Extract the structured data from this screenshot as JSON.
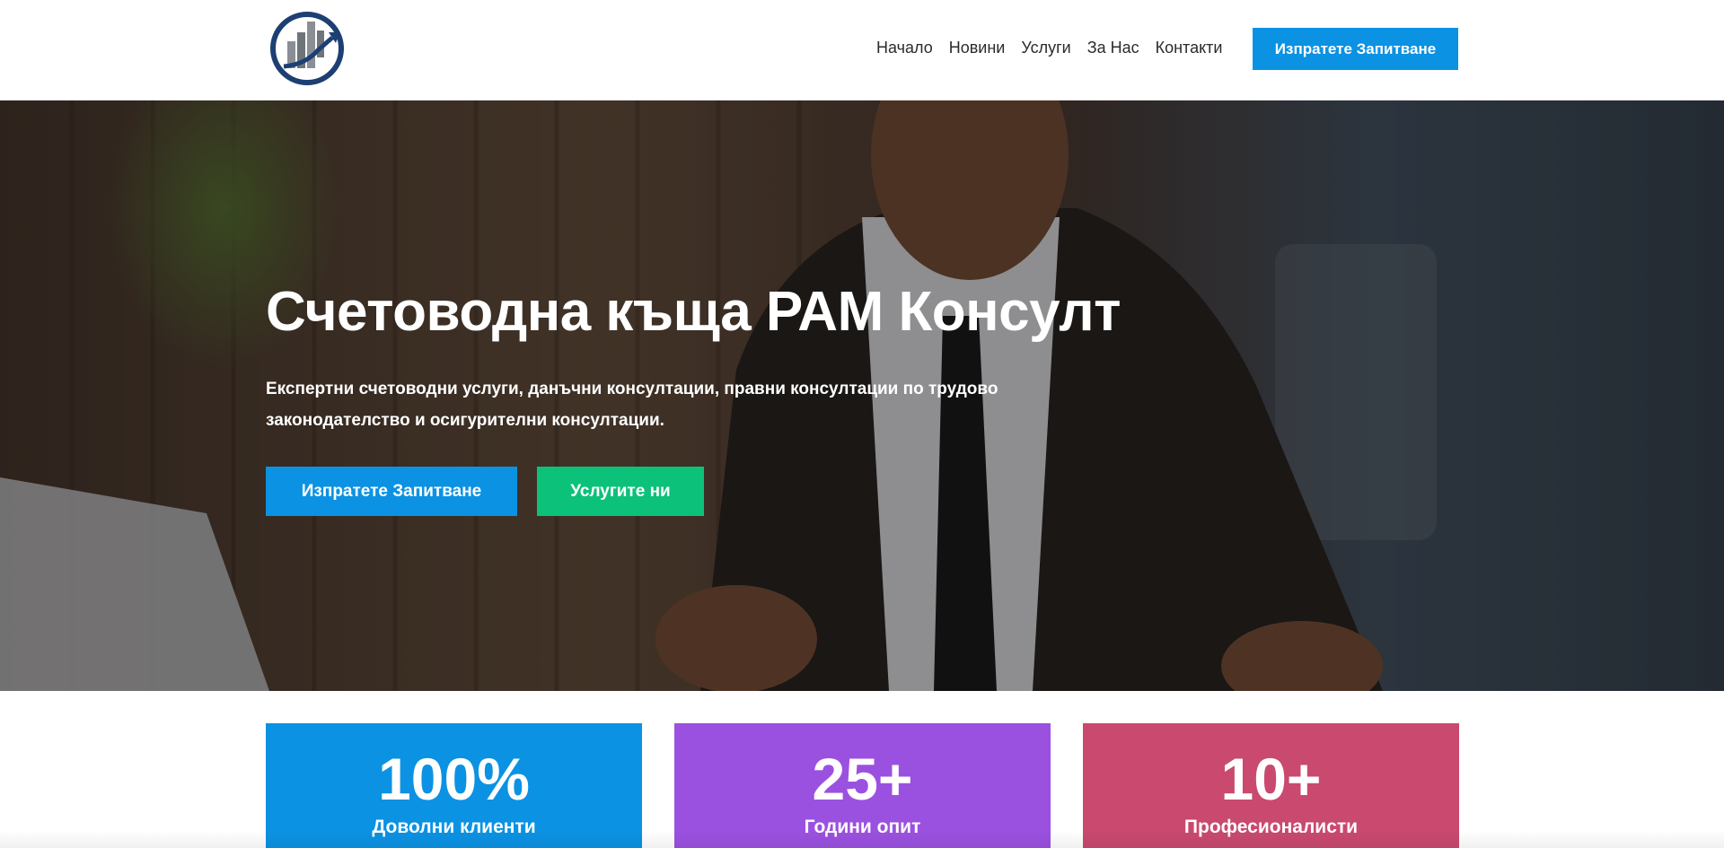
{
  "header": {
    "nav": [
      "Начало",
      "Новини",
      "Услуги",
      "За Нас",
      "Контакти"
    ],
    "cta_label": "Изпратете Запитване"
  },
  "hero": {
    "title": "Счетоводна къща РАМ Консулт",
    "subtitle_line1": "Експертни счетоводни услуги, данъчни консултации, правни консултации по трудово",
    "subtitle_line2": "законодателство и осигурителни консултации.",
    "primary_button": "Изпратете Запитване",
    "secondary_button": "Услугите ни"
  },
  "stats": [
    {
      "value": "100%",
      "label": "Доволни клиенти"
    },
    {
      "value": "25+",
      "label": "Години опит"
    },
    {
      "value": "10+",
      "label": "Професионалисти"
    }
  ],
  "colors": {
    "primary": "#0b92e3",
    "green": "#0cc17a",
    "purple": "#9b51e0",
    "pink": "#c9496f"
  },
  "icons": {
    "logo": "bar-chart-growth-logo"
  }
}
